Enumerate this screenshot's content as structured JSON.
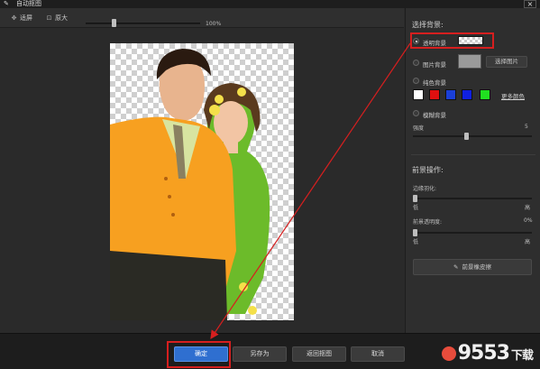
{
  "window": {
    "title": "自动抠图",
    "close_label": "×"
  },
  "toolbar": {
    "fit_label": "适屏",
    "original_label": "原大",
    "zoom_value": "100%",
    "zoom_level": 0.25
  },
  "panel": {
    "background_title": "选择背景:",
    "options": {
      "transparent": "透明背景",
      "image": "图片背景",
      "solid": "纯色背景",
      "blur": "模糊背景"
    },
    "select_image_label": "选择图片",
    "more_colors_label": "更多颜色",
    "colors": [
      "#ffffff",
      "#e01010",
      "#1a3fd8",
      "#1020e0",
      "#20e020"
    ],
    "strength_label": "强度",
    "strength_value": "5",
    "foreground_title": "前景操作:",
    "edge_feather_label": "边缘羽化:",
    "opacity_label": "前景透明度:",
    "opacity_value": "0%",
    "low_label": "低",
    "high_label": "高",
    "eraser_label": "前景橡皮擦"
  },
  "footer": {
    "ok_label": "确定",
    "saveas_label": "另存为",
    "back_label": "返回抠图",
    "cancel_label": "取消",
    "watermark_num": "9553",
    "watermark_text": "下载"
  },
  "accent": {
    "highlight": "#d61f1f",
    "primary": "#2f6fd0"
  }
}
